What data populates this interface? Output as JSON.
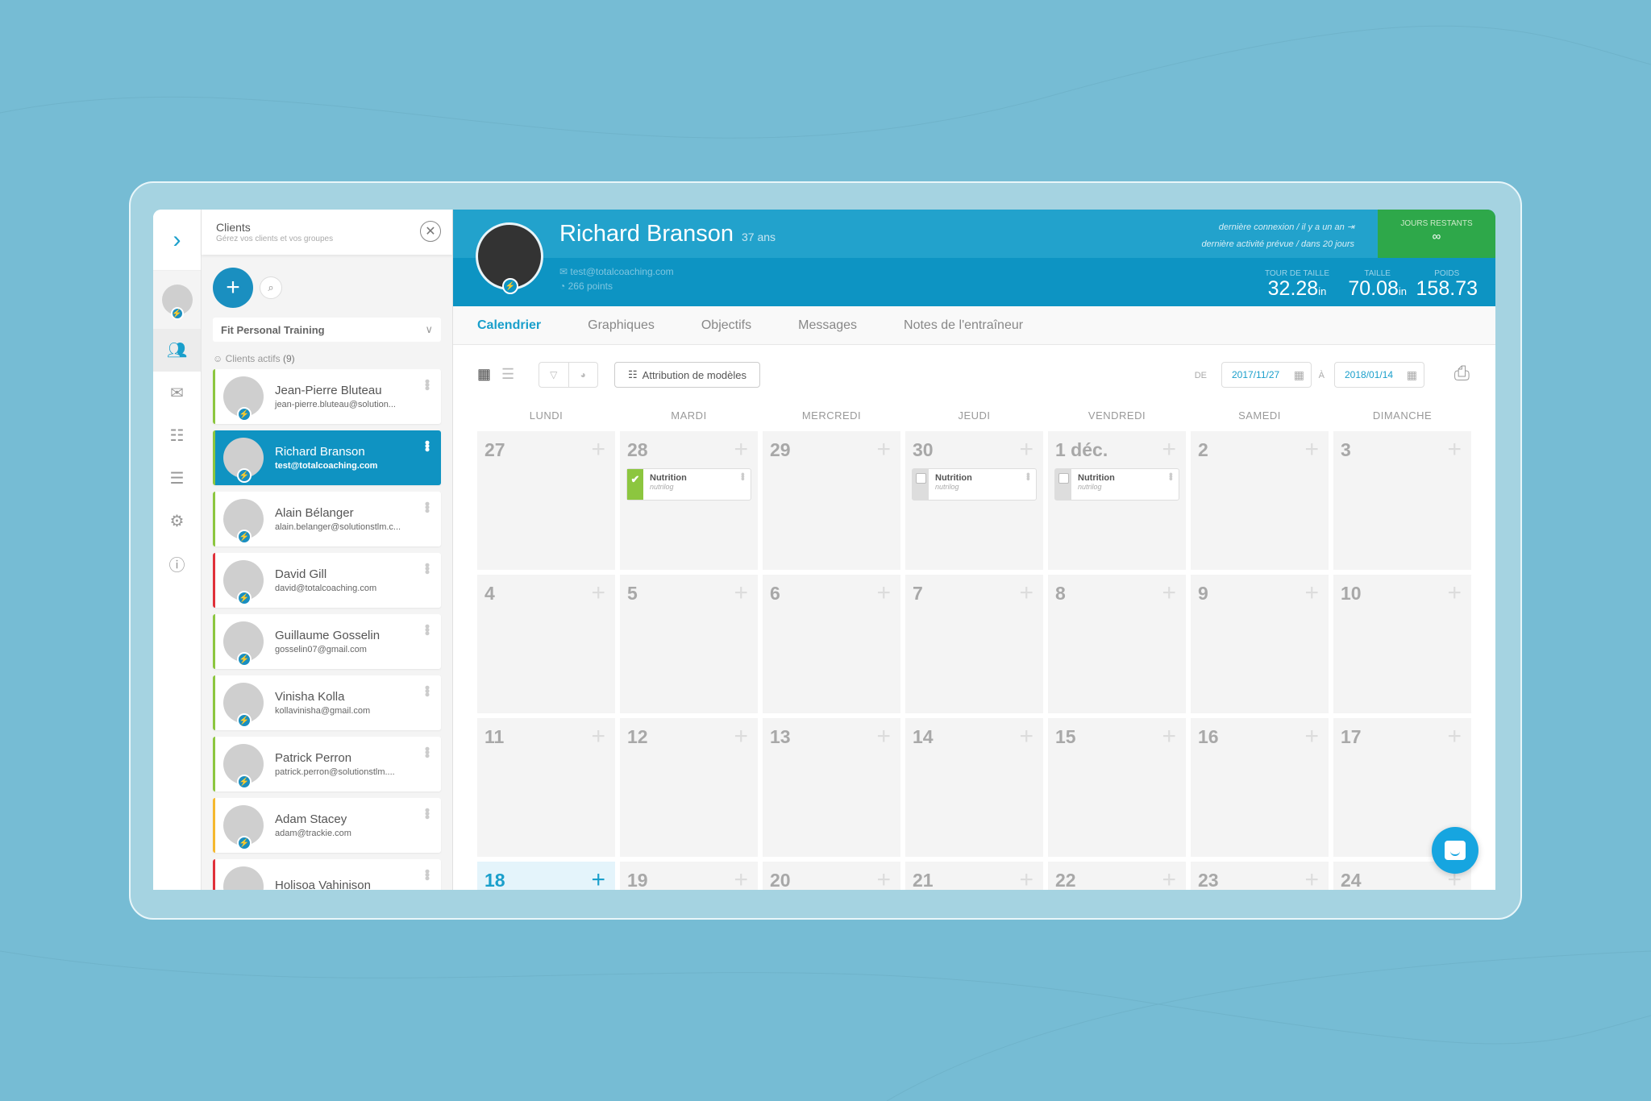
{
  "sidebar_rail": {
    "toggle_icon": "chevron-right-icon",
    "items": [
      {
        "name": "clients",
        "icon": "users-icon",
        "active": true
      },
      {
        "name": "messages",
        "icon": "mail-icon"
      },
      {
        "name": "templates",
        "icon": "hierarchy-icon"
      },
      {
        "name": "chat",
        "icon": "comment-icon"
      },
      {
        "name": "settings",
        "icon": "gear-icon"
      },
      {
        "name": "help",
        "icon": "help-icon"
      }
    ]
  },
  "clients_panel": {
    "title": "Clients",
    "subtitle": "Gérez vos clients et vos groupes",
    "group_select": "Fit Personal Training",
    "active_label": "Clients actifs",
    "active_count": "(9)",
    "clients": [
      {
        "name": "Jean-Pierre Bluteau",
        "email": "jean-pierre.bluteau@solution...",
        "status_color": "#8cc63f",
        "selected": false
      },
      {
        "name": "Richard Branson",
        "email": "test@totalcoaching.com",
        "status_color": "#8cc63f",
        "selected": true
      },
      {
        "name": "Alain Bélanger",
        "email": "alain.belanger@solutionstlm.c...",
        "status_color": "#8cc63f",
        "selected": false
      },
      {
        "name": "David Gill",
        "email": "david@totalcoaching.com",
        "status_color": "#e0303a",
        "selected": false
      },
      {
        "name": "Guillaume Gosselin",
        "email": "gosselin07@gmail.com",
        "status_color": "#8cc63f",
        "selected": false
      },
      {
        "name": "Vinisha Kolla",
        "email": "kollavinisha@gmail.com",
        "status_color": "#8cc63f",
        "selected": false
      },
      {
        "name": "Patrick Perron",
        "email": "patrick.perron@solutionstlm....",
        "status_color": "#8cc63f",
        "selected": false
      },
      {
        "name": "Adam Stacey",
        "email": "adam@trackie.com",
        "status_color": "#f5b82e",
        "selected": false
      },
      {
        "name": "Holisoa Vahinison",
        "email": "",
        "status_color": "#e0303a",
        "selected": false
      }
    ]
  },
  "profile": {
    "name": "Richard Branson",
    "age": "37 ans",
    "email": "test@totalcoaching.com",
    "points": "266 points",
    "last_login": "dernière connexion / il y a un an",
    "last_activity": "dernière activité prévue / dans 20 jours",
    "days_left_label": "JOURS RESTANTS",
    "days_left_value": "∞",
    "measures": [
      {
        "label": "TOUR DE TAILLE",
        "value": "32.28",
        "unit": "in"
      },
      {
        "label": "TAILLE",
        "value": "70.08",
        "unit": "in"
      },
      {
        "label": "POIDS",
        "value": "158.73",
        "unit": ""
      }
    ]
  },
  "tabs": [
    "Calendrier",
    "Graphiques",
    "Objectifs",
    "Messages",
    "Notes de l'entraîneur"
  ],
  "toolbar": {
    "attribution_label": "Attribution de modèles",
    "from_label": "DE",
    "from_date": "2017/11/27",
    "to_label": "À",
    "to_date": "2018/01/14"
  },
  "calendar": {
    "weekdays": [
      "LUNDI",
      "MARDI",
      "MERCREDI",
      "JEUDI",
      "VENDREDI",
      "SAMEDI",
      "DIMANCHE"
    ],
    "days": [
      {
        "label": "27"
      },
      {
        "label": "28",
        "event": {
          "title": "Nutrition",
          "sub": "nutrilog",
          "done": true
        }
      },
      {
        "label": "29"
      },
      {
        "label": "30",
        "event": {
          "title": "Nutrition",
          "sub": "nutrilog",
          "done": false
        }
      },
      {
        "label": "1 déc.",
        "event": {
          "title": "Nutrition",
          "sub": "nutrilog",
          "done": false
        }
      },
      {
        "label": "2"
      },
      {
        "label": "3"
      },
      {
        "label": "4"
      },
      {
        "label": "5"
      },
      {
        "label": "6"
      },
      {
        "label": "7"
      },
      {
        "label": "8"
      },
      {
        "label": "9"
      },
      {
        "label": "10"
      },
      {
        "label": "11"
      },
      {
        "label": "12"
      },
      {
        "label": "13"
      },
      {
        "label": "14"
      },
      {
        "label": "15"
      },
      {
        "label": "16"
      },
      {
        "label": "17"
      },
      {
        "label": "18",
        "today": true
      },
      {
        "label": "19"
      },
      {
        "label": "20"
      },
      {
        "label": "21"
      },
      {
        "label": "22"
      },
      {
        "label": "23"
      },
      {
        "label": "24"
      }
    ]
  },
  "colors": {
    "primary": "#0d94c3",
    "green": "#2ea84a",
    "done": "#8cc63f"
  }
}
